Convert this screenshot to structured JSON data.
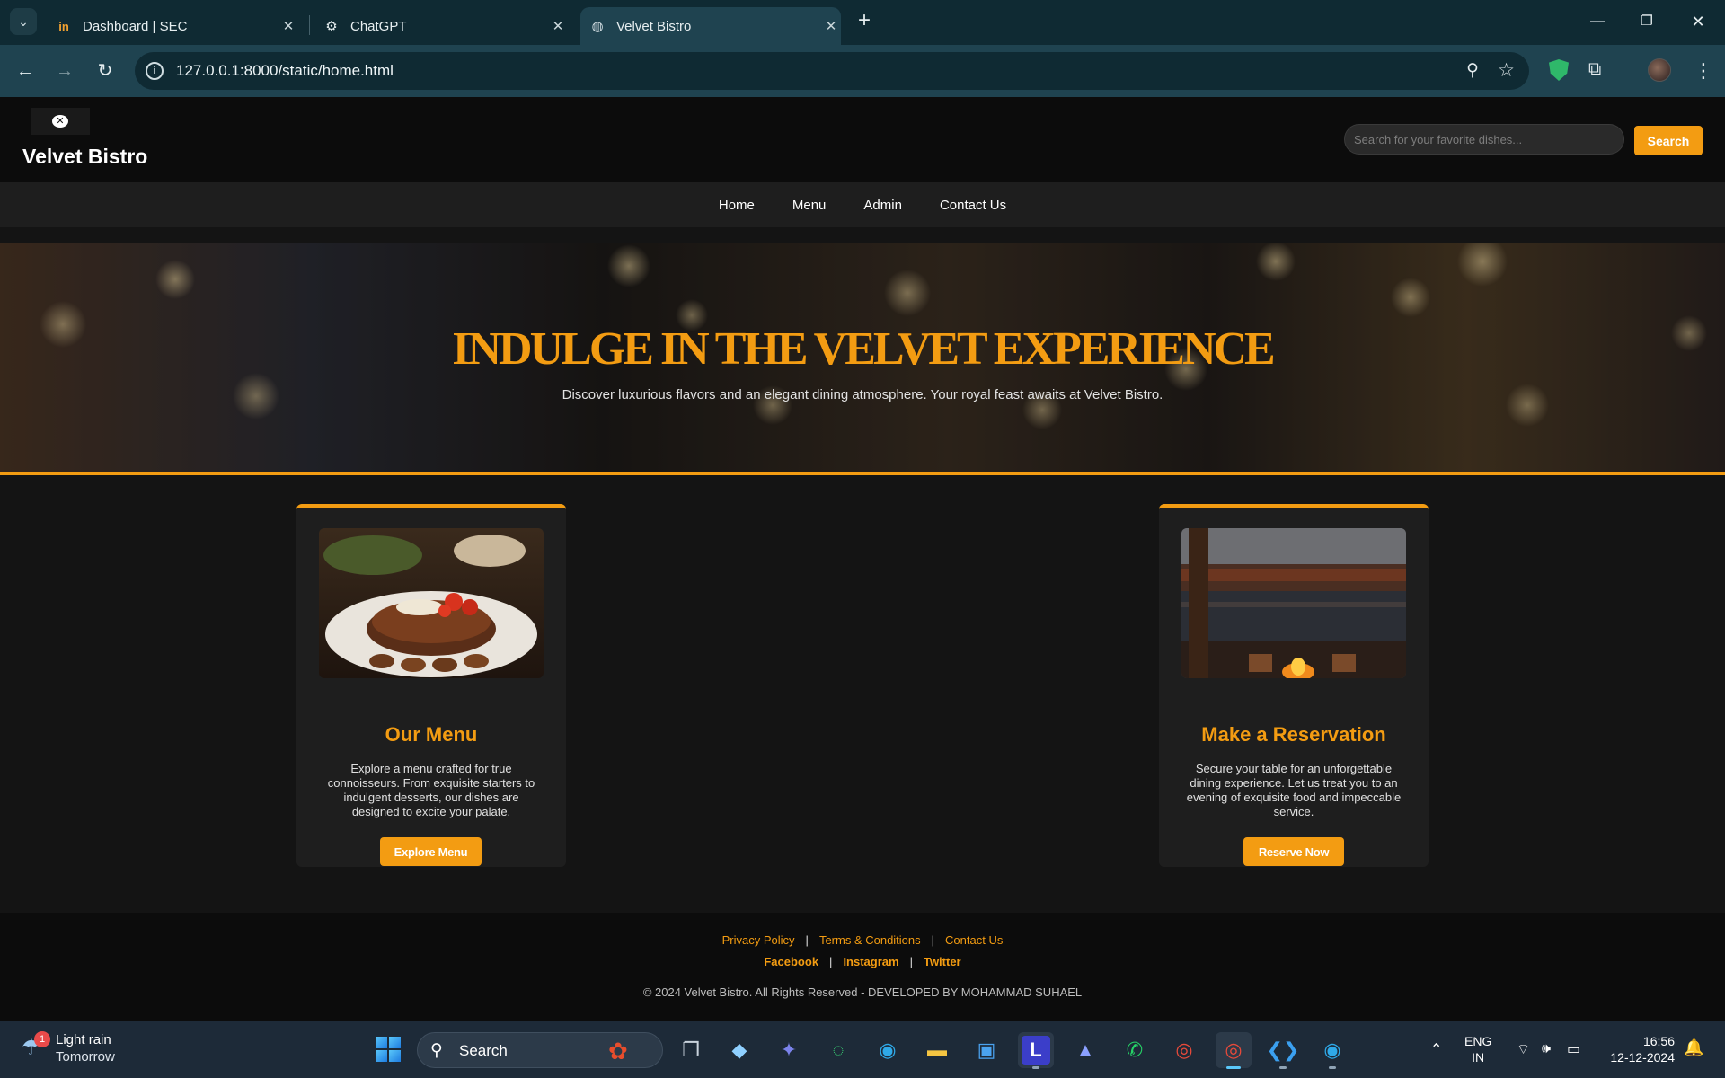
{
  "browser": {
    "tabs": [
      {
        "title": "Dashboard | SEC",
        "icon": "sec-favicon-icon",
        "active": false
      },
      {
        "title": "ChatGPT",
        "icon": "chatgpt-favicon-icon",
        "active": false
      },
      {
        "title": "Velvet Bistro",
        "icon": "globe-favicon-icon",
        "active": true
      }
    ],
    "url": "127.0.0.1:8000/static/home.html"
  },
  "site": {
    "brand": "Velvet Bistro",
    "search_placeholder": "Search for your favorite dishes...",
    "search_button": "Search",
    "nav": [
      "Home",
      "Menu",
      "Admin",
      "Contact Us"
    ],
    "accent_color": "#f39c12",
    "hero": {
      "title": "INDULGE IN THE VELVET EXPERIENCE",
      "subtitle": "Discover luxurious flavors and an elegant dining atmosphere. Your royal feast awaits at Velvet Bistro."
    },
    "cards": [
      {
        "title": "Our Menu",
        "text": "Explore a menu crafted for true connoisseurs. From exquisite starters to indulgent desserts, our dishes are designed to excite your palate.",
        "button": "Explore Menu"
      },
      {
        "title": "Make a Reservation",
        "text": "Secure your table for an unforgettable dining experience. Let us treat you to an evening of exquisite food and impeccable service.",
        "button": "Reserve Now"
      }
    ],
    "footer": {
      "links": [
        "Privacy Policy",
        "Terms & Conditions",
        "Contact Us"
      ],
      "social": [
        "Facebook",
        "Instagram",
        "Twitter"
      ],
      "copyright": "© 2024 Velvet Bistro. All Rights Reserved - DEVELOPED BY MOHAMMAD SUHAEL"
    }
  },
  "taskbar": {
    "weather": {
      "title": "Light rain",
      "subtitle": "Tomorrow",
      "badge": "1"
    },
    "search_label": "Search",
    "language": {
      "line1": "ENG",
      "line2": "IN"
    },
    "time": "16:56",
    "date": "12-12-2024"
  }
}
